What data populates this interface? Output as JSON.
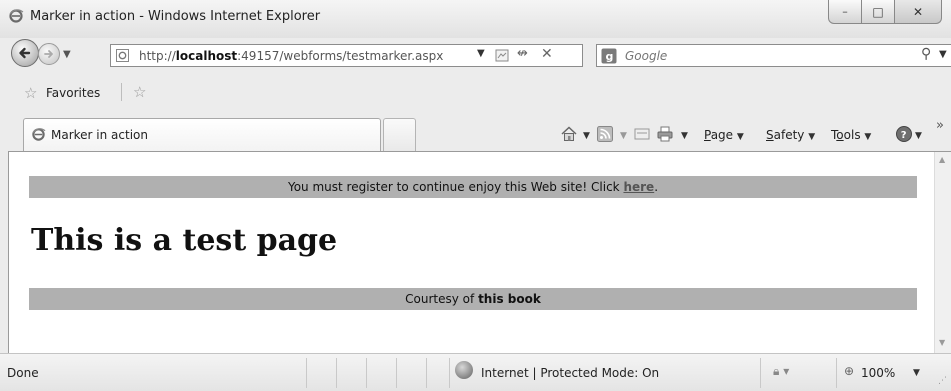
{
  "window": {
    "title": "Marker in action - Windows Internet Explorer",
    "minimize_glyph": "–",
    "maximize_glyph": "□",
    "close_glyph": "✕"
  },
  "address_bar": {
    "url_prefix": "http://",
    "url_host": "localhost",
    "url_rest": ":49157/webforms/testmarker.aspx"
  },
  "search": {
    "placeholder": "Google"
  },
  "favorites_bar": {
    "label": "Favorites"
  },
  "tabs": [
    {
      "label": "Marker in action",
      "active": true
    }
  ],
  "command_bar": {
    "page_label_rest": "age",
    "page_accesskey": "P",
    "safety_label_rest": "afety",
    "safety_accesskey": "S",
    "tools_label_start": "T",
    "tools_accesskey": "o",
    "tools_label_rest": "ols",
    "more_glyph": "»"
  },
  "page": {
    "top_banner_text": "You must register to continue enjoy this Web site! Click",
    "top_banner_link": "here",
    "top_banner_end": ".",
    "heading": "This is a test page",
    "bottom_banner_text": "Courtesy of",
    "bottom_banner_bold": "this book"
  },
  "status_bar": {
    "status": "Done",
    "zone": "Internet | Protected Mode: On",
    "zoom": "100%"
  },
  "colors": {
    "banner_bg": "#b0b0b0",
    "link": "#555555"
  }
}
